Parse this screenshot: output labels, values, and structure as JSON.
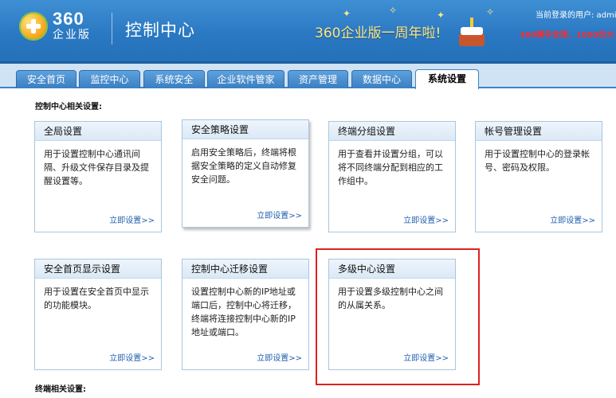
{
  "header": {
    "brand_number": "360",
    "brand_sub": "企业版",
    "title": "控制中心",
    "anniversary_banner": "360企业版一周年啦!",
    "login_label": "当前登录的用户: admin",
    "promo": "360携手全球，1000份大"
  },
  "tabs": [
    {
      "label": "安全首页"
    },
    {
      "label": "监控中心"
    },
    {
      "label": "系统安全"
    },
    {
      "label": "企业软件管家"
    },
    {
      "label": "资产管理"
    },
    {
      "label": "数据中心"
    },
    {
      "label": "系统设置",
      "active": true
    }
  ],
  "sections": {
    "control_center": "控制中心相关设置:",
    "terminal": "终端相关设置:"
  },
  "cards": [
    {
      "title": "全局设置",
      "desc": "用于设置控制中心通讯间隔、升级文件保存目录及提醒设置等。",
      "link": "立即设置>>"
    },
    {
      "title": "安全策略设置",
      "desc": "启用安全策略后，终端将根据安全策略的定义自动修复安全问题。",
      "link": "立即设置>>"
    },
    {
      "title": "终端分组设置",
      "desc": "用于查看并设置分组，可以将不同终端分配到相应的工作组中。",
      "link": "立即设置>>"
    },
    {
      "title": "帐号管理设置",
      "desc": "用于设置控制中心的登录帐号、密码及权限。",
      "link": "立即设置>>"
    },
    {
      "title": "安全首页显示设置",
      "desc": "用于设置在安全首页中显示的功能模块。",
      "link": "立即设置>>"
    },
    {
      "title": "控制中心迁移设置",
      "desc": "设置控制中心新的IP地址或端口后，控制中心将迁移，终端将连接控制中心新的IP地址或端口。",
      "link": "立即设置>>"
    },
    {
      "title": "多级中心设置",
      "desc": "用于设置多级控制中心之间的从属关系。",
      "link": "立即设置>>"
    }
  ],
  "colors": {
    "header_blue": "#2a78c2",
    "link_blue": "#1f5fb0",
    "highlight_red": "#e02020"
  }
}
